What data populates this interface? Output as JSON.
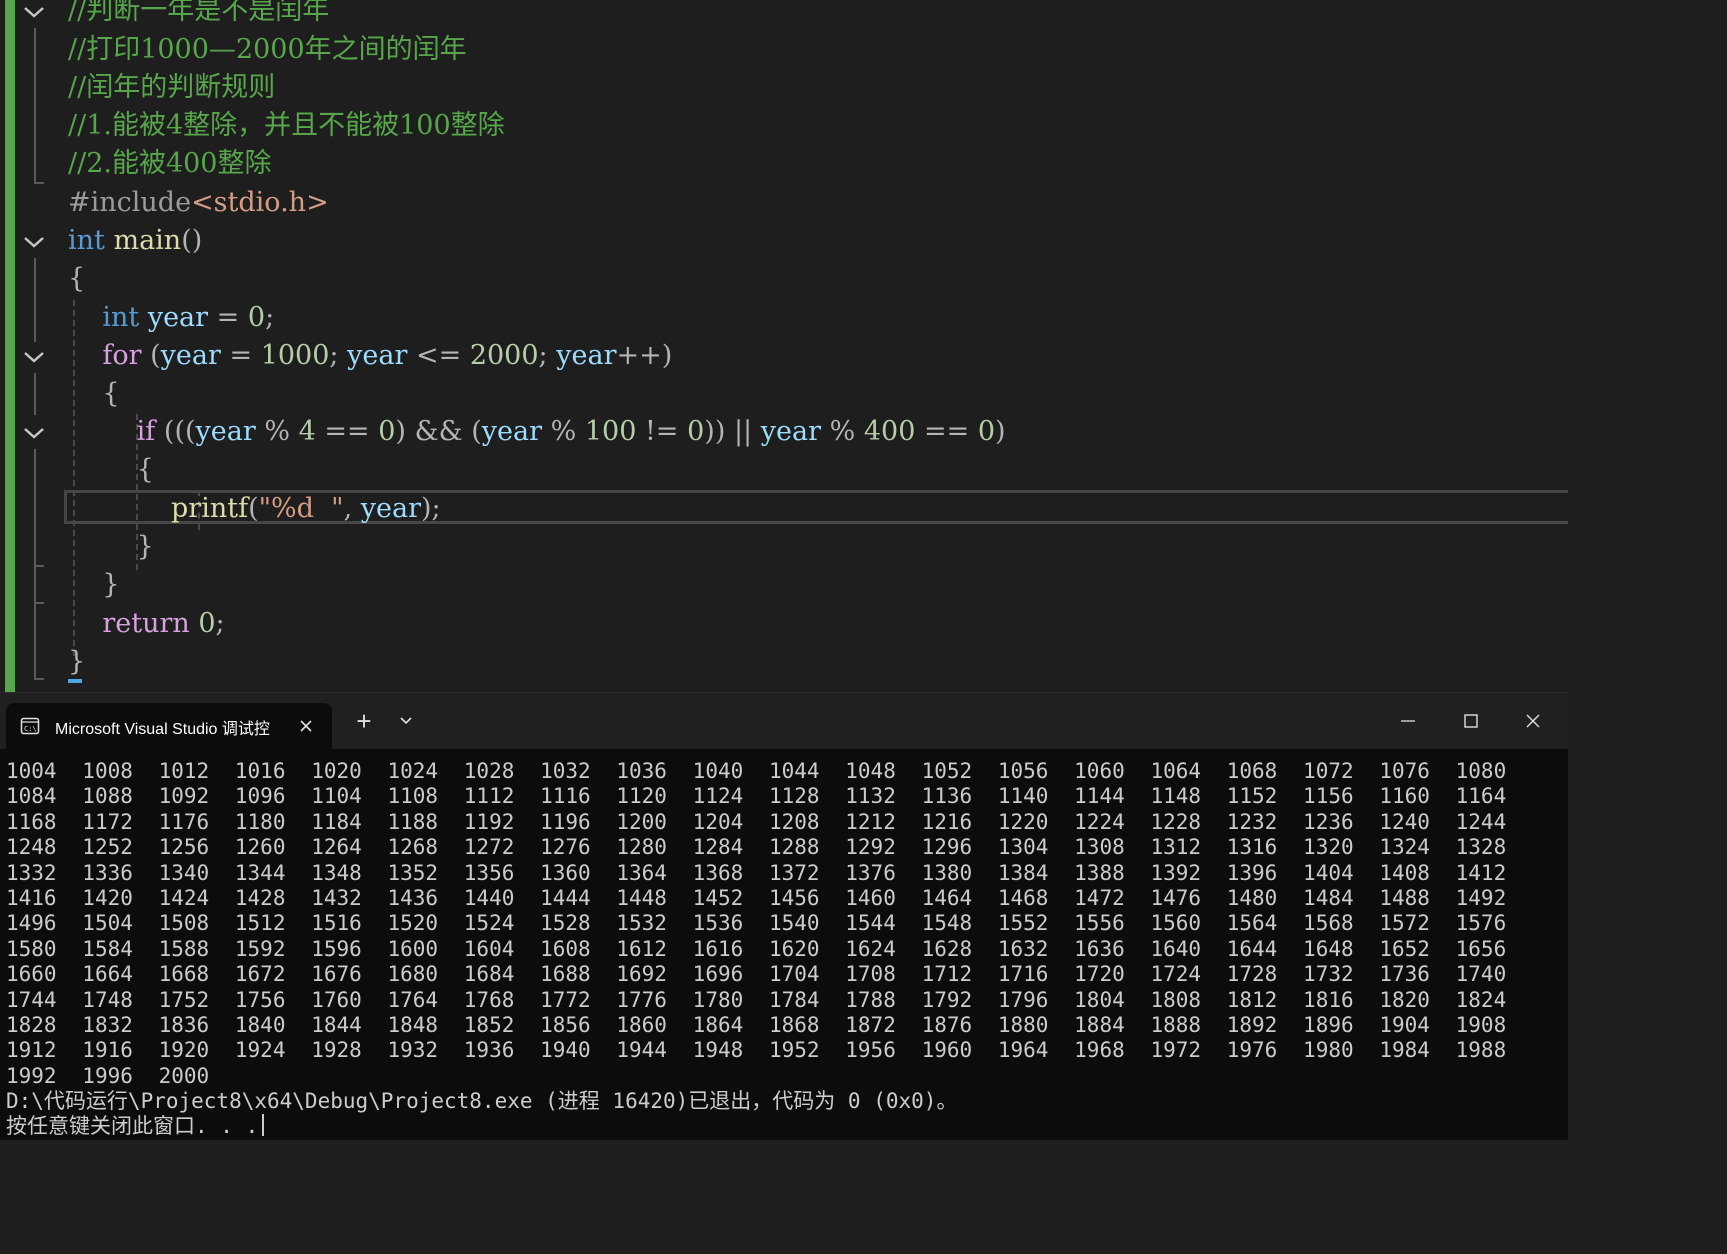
{
  "editor": {
    "comments": [
      "//判断一年是不是闰年",
      "//打印1000—2000年之间的闰年",
      "//闰年的判断规则",
      "//1.能被4整除，并且不能被100整除",
      "//2.能被400整除"
    ],
    "include_directive": "#include",
    "include_file": "<stdio.h>",
    "kw_int": "int",
    "main_name": "main",
    "kw_for": "for",
    "kw_if": "if",
    "kw_return": "return",
    "var_year": "year",
    "printf_name": "printf",
    "format_string": "\"%d  \"",
    "n_0": "0",
    "n_4": "4",
    "n_100": "100",
    "n_400": "400",
    "n_1000": "1000",
    "n_2000": "2000"
  },
  "console": {
    "tab_title": "Microsoft Visual Studio 调试控",
    "new_tab_label": "+",
    "dropdown_icon": "chevron-down-icon",
    "output_rows": [
      [
        "1004",
        "1008",
        "1012",
        "1016",
        "1020",
        "1024",
        "1028",
        "1032",
        "1036",
        "1040",
        "1044",
        "1048",
        "1052",
        "1056",
        "1060",
        "1064",
        "1068",
        "1072",
        "1076",
        "1080"
      ],
      [
        "1084",
        "1088",
        "1092",
        "1096",
        "1104",
        "1108",
        "1112",
        "1116",
        "1120",
        "1124",
        "1128",
        "1132",
        "1136",
        "1140",
        "1144",
        "1148",
        "1152",
        "1156",
        "1160",
        "1164"
      ],
      [
        "1168",
        "1172",
        "1176",
        "1180",
        "1184",
        "1188",
        "1192",
        "1196",
        "1200",
        "1204",
        "1208",
        "1212",
        "1216",
        "1220",
        "1224",
        "1228",
        "1232",
        "1236",
        "1240",
        "1244"
      ],
      [
        "1248",
        "1252",
        "1256",
        "1260",
        "1264",
        "1268",
        "1272",
        "1276",
        "1280",
        "1284",
        "1288",
        "1292",
        "1296",
        "1304",
        "1308",
        "1312",
        "1316",
        "1320",
        "1324",
        "1328"
      ],
      [
        "1332",
        "1336",
        "1340",
        "1344",
        "1348",
        "1352",
        "1356",
        "1360",
        "1364",
        "1368",
        "1372",
        "1376",
        "1380",
        "1384",
        "1388",
        "1392",
        "1396",
        "1404",
        "1408",
        "1412"
      ],
      [
        "1416",
        "1420",
        "1424",
        "1428",
        "1432",
        "1436",
        "1440",
        "1444",
        "1448",
        "1452",
        "1456",
        "1460",
        "1464",
        "1468",
        "1472",
        "1476",
        "1480",
        "1484",
        "1488",
        "1492"
      ],
      [
        "1496",
        "1504",
        "1508",
        "1512",
        "1516",
        "1520",
        "1524",
        "1528",
        "1532",
        "1536",
        "1540",
        "1544",
        "1548",
        "1552",
        "1556",
        "1560",
        "1564",
        "1568",
        "1572",
        "1576"
      ],
      [
        "1580",
        "1584",
        "1588",
        "1592",
        "1596",
        "1600",
        "1604",
        "1608",
        "1612",
        "1616",
        "1620",
        "1624",
        "1628",
        "1632",
        "1636",
        "1640",
        "1644",
        "1648",
        "1652",
        "1656"
      ],
      [
        "1660",
        "1664",
        "1668",
        "1672",
        "1676",
        "1680",
        "1684",
        "1688",
        "1692",
        "1696",
        "1704",
        "1708",
        "1712",
        "1716",
        "1720",
        "1724",
        "1728",
        "1732",
        "1736",
        "1740"
      ],
      [
        "1744",
        "1748",
        "1752",
        "1756",
        "1760",
        "1764",
        "1768",
        "1772",
        "1776",
        "1780",
        "1784",
        "1788",
        "1792",
        "1796",
        "1804",
        "1808",
        "1812",
        "1816",
        "1820",
        "1824"
      ],
      [
        "1828",
        "1832",
        "1836",
        "1840",
        "1844",
        "1848",
        "1852",
        "1856",
        "1860",
        "1864",
        "1868",
        "1872",
        "1876",
        "1880",
        "1884",
        "1888",
        "1892",
        "1896",
        "1904",
        "1908"
      ],
      [
        "1912",
        "1916",
        "1920",
        "1924",
        "1928",
        "1932",
        "1936",
        "1940",
        "1944",
        "1948",
        "1952",
        "1956",
        "1960",
        "1964",
        "1968",
        "1972",
        "1976",
        "1980",
        "1984",
        "1988"
      ],
      [
        "1992",
        "1996",
        "2000"
      ]
    ],
    "exit_message": "D:\\代码运行\\Project8\\x64\\Debug\\Project8.exe (进程 16420)已退出，代码为 0 (0x0)。",
    "prompt_message": "按任意键关闭此窗口. . ."
  },
  "colors": {
    "comment": "#57a64a",
    "keyword": "#569cd6",
    "control": "#d8a0df",
    "variable": "#9cdcfe",
    "number": "#b5cea8",
    "function": "#dcdcaa",
    "string": "#d69d85",
    "console_bg": "#0c0c0c",
    "titlebar_bg": "#202020"
  }
}
